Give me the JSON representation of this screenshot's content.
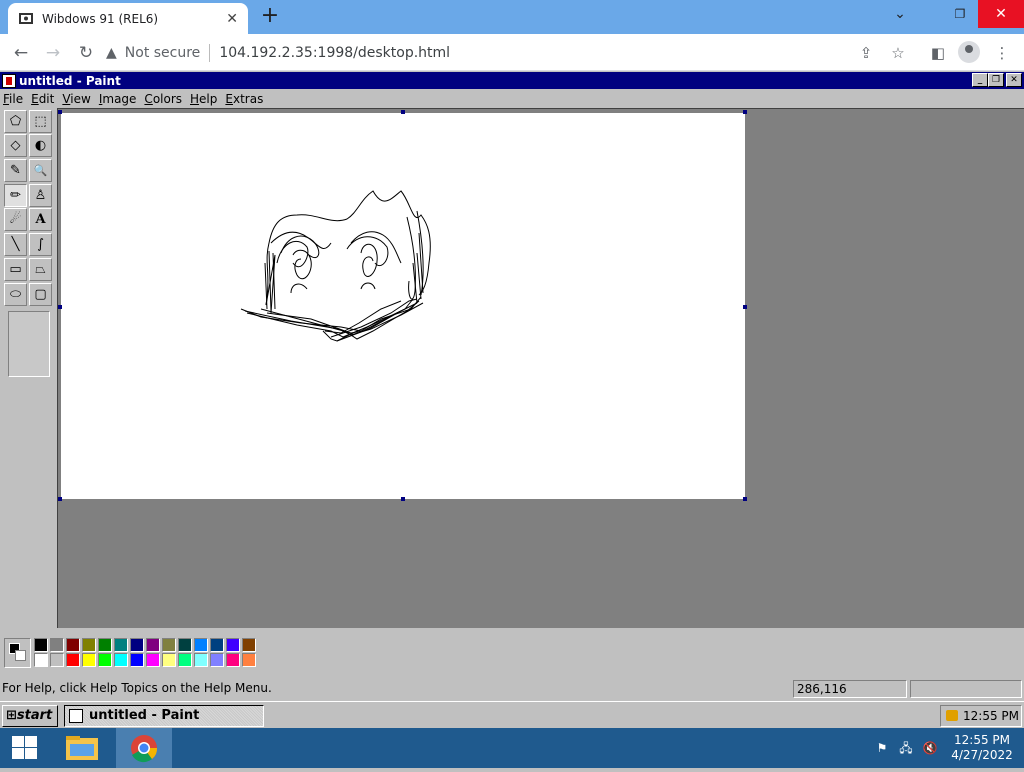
{
  "browser": {
    "tab_title": "Wibdows 91 (REL6)",
    "tab_close": "✕",
    "new_tab": "+",
    "security_label": "Not secure",
    "url": "104.192.2.35:1998/desktop.html",
    "controls": {
      "minimize": "⌄",
      "restore": "❐",
      "close": "✕",
      "maximize_alt": "—"
    }
  },
  "paint": {
    "title": "untitled - Paint",
    "menus": [
      "File",
      "Edit",
      "View",
      "Image",
      "Colors",
      "Help",
      "Extras"
    ],
    "tools": [
      {
        "name": "free-form-select",
        "glyph": "⬠"
      },
      {
        "name": "rect-select",
        "glyph": "⬚"
      },
      {
        "name": "eraser",
        "glyph": "◇"
      },
      {
        "name": "fill",
        "glyph": "◐"
      },
      {
        "name": "color-picker",
        "glyph": "✎"
      },
      {
        "name": "magnifier",
        "glyph": "🔍"
      },
      {
        "name": "pencil",
        "glyph": "✏"
      },
      {
        "name": "brush",
        "glyph": "♙"
      },
      {
        "name": "airbrush",
        "glyph": "☄"
      },
      {
        "name": "text",
        "glyph": "A"
      },
      {
        "name": "line",
        "glyph": "╲"
      },
      {
        "name": "curve",
        "glyph": "∫"
      },
      {
        "name": "rectangle",
        "glyph": "▭"
      },
      {
        "name": "polygon",
        "glyph": "⏢"
      },
      {
        "name": "ellipse",
        "glyph": "⬭"
      },
      {
        "name": "rounded-rectangle",
        "glyph": "▢"
      }
    ],
    "active_tool": "pencil",
    "palette_top": [
      "#000000",
      "#808080",
      "#800000",
      "#808000",
      "#008000",
      "#008080",
      "#000080",
      "#800080",
      "#808040",
      "#004040",
      "#0080ff",
      "#004080",
      "#4000ff",
      "#804000"
    ],
    "palette_bottom": [
      "#ffffff",
      "#c0c0c0",
      "#ff0000",
      "#ffff00",
      "#00ff00",
      "#00ffff",
      "#0000ff",
      "#ff00ff",
      "#ffff80",
      "#00ff80",
      "#80ffff",
      "#8080ff",
      "#ff0080",
      "#ff8040"
    ],
    "foreground": "#000000",
    "background": "#ffffff",
    "status_help": "For Help, click Help Topics on the Help Menu.",
    "status_coords": "286,116"
  },
  "taskbar": {
    "start_label": "start",
    "task_label": "untitled - Paint",
    "time": "12:55 PM"
  },
  "host": {
    "time": "12:55 PM",
    "date": "4/27/2022"
  }
}
